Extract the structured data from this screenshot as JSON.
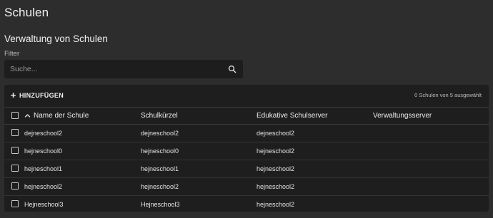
{
  "page": {
    "title": "Schulen"
  },
  "section": {
    "title": "Verwaltung von Schulen"
  },
  "filter": {
    "label": "Filter",
    "placeholder": "Suche...",
    "value": "",
    "icon": "search-icon"
  },
  "toolbar": {
    "add_icon": "plus-icon",
    "add_label": "HINZUFÜGEN",
    "selection_status": "0 Schulen von 5 ausgewählt"
  },
  "table": {
    "sort_icon": "arrow-up-icon",
    "columns": {
      "name": "Name der Schule",
      "kurz": "Schulkürzel",
      "edu": "Edukative Schulserver",
      "verw": "Verwaltungsserver"
    },
    "rows": [
      {
        "name": "dejneschool2",
        "kurz": "dejneschool2",
        "edu": "dejneschool2",
        "verw": ""
      },
      {
        "name": "hejneschool0",
        "kurz": "hejneschool0",
        "edu": "hejneschool2",
        "verw": ""
      },
      {
        "name": "hejneschool1",
        "kurz": "hejneschool1",
        "edu": "hejneschool2",
        "verw": ""
      },
      {
        "name": "hejneschool2",
        "kurz": "hejneschool2",
        "edu": "hejneschool2",
        "verw": ""
      },
      {
        "name": "Hejneschool3",
        "kurz": "Hejneschool3",
        "edu": "hejneschool2",
        "verw": ""
      }
    ]
  },
  "colors": {
    "background": "#2d2d2d",
    "surface": "#1e1e1e",
    "text": "#e6e6e6",
    "muted_text": "#bcbcbc"
  }
}
